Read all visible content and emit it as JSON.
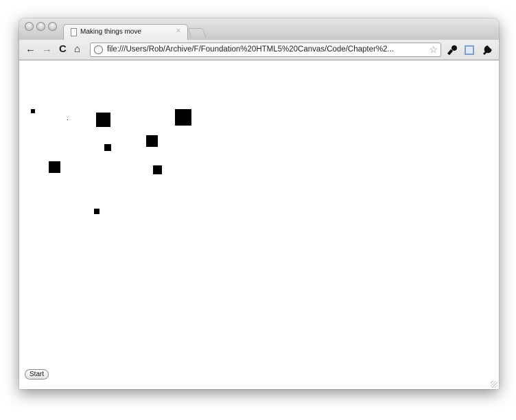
{
  "browser": {
    "tab": {
      "title": "Making things move",
      "close_glyph": "×"
    },
    "toolbar": {
      "back_glyph": "←",
      "forward_glyph": "→",
      "reload_glyph": "C",
      "home_glyph": "⌂",
      "url": "file:///Users/Rob/Archive/F/Foundation%20HTML5%20Canvas/Code/Chapter%2...",
      "star_glyph": "☆",
      "wrench_glyph": "🔧"
    }
  },
  "canvas": {
    "start_button_label": "Start"
  },
  "colors": {
    "square": "#000000",
    "titlebar": "#d4d4d4",
    "page_background": "#ffffff"
  }
}
